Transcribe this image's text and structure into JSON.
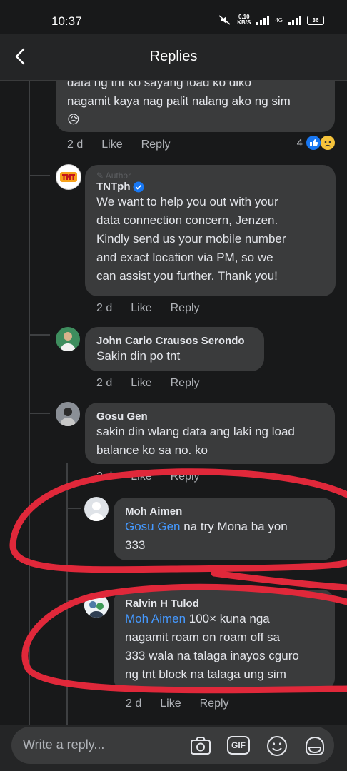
{
  "status": {
    "time": "10:37",
    "speed_top": "0.10",
    "speed_unit": "KB/S",
    "network": "4G",
    "battery": "36"
  },
  "header": {
    "title": "Replies"
  },
  "comments": [
    {
      "lines": [
        "data ng tnt ko sayang load ko diko",
        "nagamit kaya nag palit nalang ako ng sim"
      ],
      "emoji": "😥",
      "time": "2 d",
      "like": "Like",
      "reply": "Reply",
      "reactions_count": "4"
    },
    {
      "badge": "Author",
      "author": "TNTph",
      "lines": [
        "We want to help you out with your",
        "data connection concern, Jenzen.",
        "Kindly send us your mobile number",
        "and exact location via PM, so we",
        "can assist you further. Thank you!"
      ],
      "time": "2 d",
      "like": "Like",
      "reply": "Reply"
    },
    {
      "author": "John Carlo Crausos Serondo",
      "lines": [
        "Sakin din po tnt"
      ],
      "time": "2 d",
      "like": "Like",
      "reply": "Reply"
    },
    {
      "author": "Gosu Gen",
      "lines": [
        "sakin din wlang data ang laki ng load",
        "balance ko sa no. ko"
      ],
      "time": "2 d",
      "like": "Like",
      "reply": "Reply"
    },
    {
      "author": "Moh Aimen",
      "mention": "Gosu Gen",
      "line1": " na try Mona ba yon",
      "line2": "333"
    },
    {
      "author": "Ralvin H Tulod",
      "mention": "Moh Aimen",
      "line1": " 100× kuna nga",
      "lines": [
        "nagamit roam on roam off sa",
        "333 wala na talaga inayos cguro",
        "ng tnt block na talaga ung sim"
      ],
      "time": "2 d",
      "like": "Like",
      "reply": "Reply"
    }
  ],
  "composer": {
    "placeholder": "Write a reply...",
    "gif": "GIF",
    "icons": [
      "camera-icon",
      "gif-icon",
      "emoji-icon",
      "sticker-icon"
    ]
  },
  "colors": {
    "background": "#18191a",
    "bubble": "#3a3b3c",
    "mention": "#4599ff",
    "annotation": "#e0283a"
  }
}
